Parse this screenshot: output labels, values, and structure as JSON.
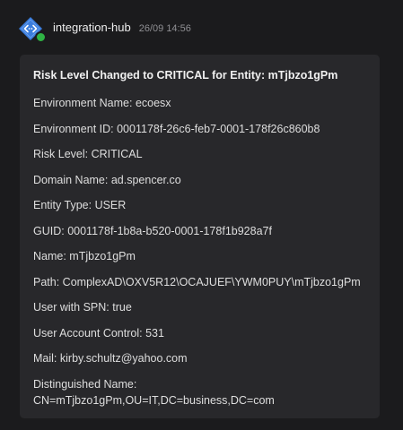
{
  "header": {
    "sender": "integration-hub",
    "timestamp": "26/09 14:56"
  },
  "colors": {
    "background": "#1b1b1d",
    "card": "#28282b",
    "avatar_blue": "#3b7ddd",
    "status_online": "#2fb344"
  },
  "icons": {
    "avatar": "code-diamond-icon",
    "status": "online-dot"
  },
  "card": {
    "title": "Risk Level Changed to CRITICAL for Entity: mTjbzo1gPm",
    "fields": [
      {
        "label": "Environment Name",
        "value": "ecoesx"
      },
      {
        "label": "Environment ID",
        "value": "0001178f-26c6-feb7-0001-178f26c860b8"
      },
      {
        "label": "Risk Level",
        "value": "CRITICAL"
      },
      {
        "label": "Domain Name",
        "value": "ad.spencer.co"
      },
      {
        "label": "Entity Type",
        "value": "USER"
      },
      {
        "label": "GUID",
        "value": "0001178f-1b8a-b520-0001-178f1b928a7f"
      },
      {
        "label": "Name",
        "value": "mTjbzo1gPm"
      },
      {
        "label": "Path",
        "value": "ComplexAD\\OXV5R12\\OCAJUEF\\YWM0PUY\\mTjbzo1gPm"
      },
      {
        "label": "User with SPN",
        "value": "true"
      },
      {
        "label": "User Account Control",
        "value": "531"
      },
      {
        "label": "Mail",
        "value": "kirby.schultz@yahoo.com"
      },
      {
        "label": "Distinguished Name",
        "value": "CN=mTjbzo1gPm,OU=IT,DC=business,DC=com"
      }
    ]
  }
}
